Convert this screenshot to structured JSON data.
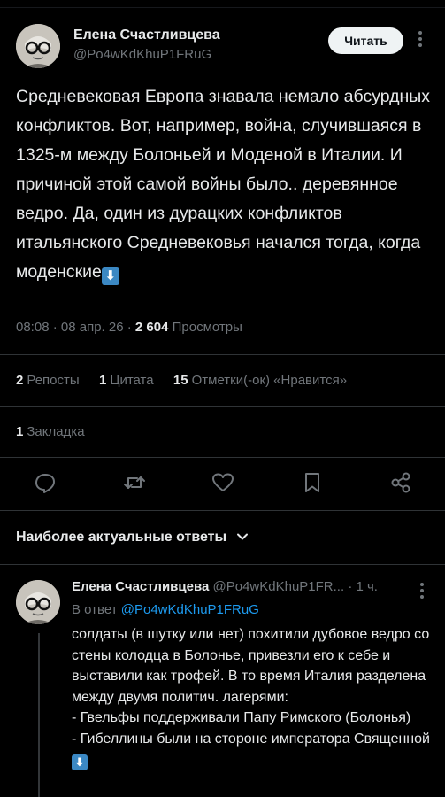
{
  "tweet": {
    "author_name": "Елена Счастливцева",
    "author_handle": "@Po4wKdKhuP1FRuG",
    "read_button": "Читать",
    "text": "Средневековая Европа знавала немало абсурдных конфликтов. Вот, например, война, случившаяся в 1325-м между Болоньей и Моденой в Италии. И причиной этой самой войны было.. деревянное ведро. Да, один из дурацких конфликтов итальянского Средневековья начался тогда, когда моденские",
    "time": "08:08",
    "date": "08 апр. 26",
    "views_count": "2 604",
    "views_label": "Просмотры"
  },
  "stats": {
    "reposts_count": "2",
    "reposts_label": "Репосты",
    "quotes_count": "1",
    "quotes_label": "Цитата",
    "likes_count": "15",
    "likes_label": "Отметки(-ок) «Нравится»",
    "bookmarks_count": "1",
    "bookmarks_label": "Закладка"
  },
  "actions": {
    "icons": [
      "reply-icon",
      "retweet-icon",
      "like-icon",
      "bookmark-icon",
      "share-icon"
    ]
  },
  "replies_header": {
    "label": "Наиболее актуальные ответы"
  },
  "reply": {
    "author_name": "Елена Счастливцева",
    "author_handle": "@Po4wKdKhuP1FR...",
    "time_ago": "· 1 ч.",
    "in_reply_prefix": "В ответ",
    "in_reply_mention": "@Po4wKdKhuP1FRuG",
    "text": "солдаты (в шутку или нет) похитили дубовое ведро со стены колодца в Болонье, привезли его к себе и выставили как трофей. В то время Италия разделена между двумя политич. лагерями:\n- Гвельфы поддерживали Папу Римского (Болонья)\n- Гибеллины были на стороне императора Священной"
  },
  "colors": {
    "background": "#000000",
    "text": "#e7e9ea",
    "muted": "#71767b",
    "accent": "#1d9bf0",
    "divider": "#2f3336"
  }
}
